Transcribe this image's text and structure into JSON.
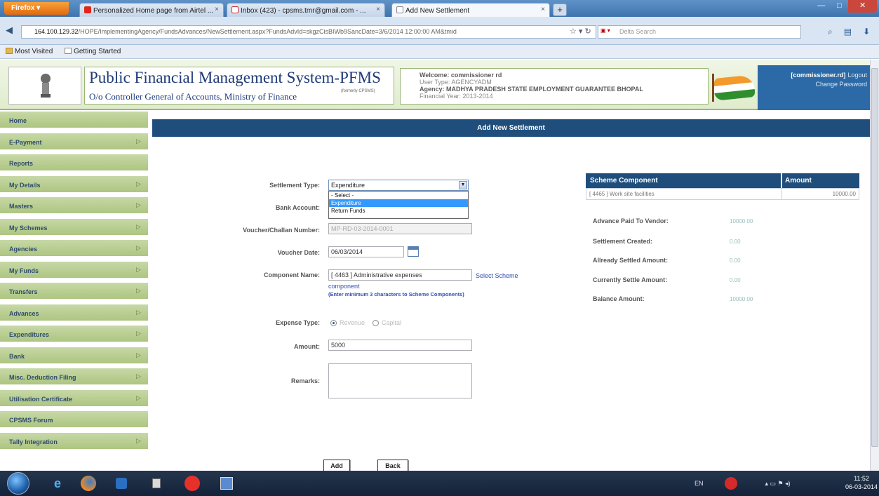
{
  "browser": {
    "menu_label": "Firefox",
    "tabs": [
      {
        "title": "Personalized Home page from Airtel ...",
        "icon": "airtel-icon"
      },
      {
        "title": "Inbox (423) - cpsms.tmr@gmail.com - ...",
        "icon": "gmail-icon"
      },
      {
        "title": "Add New Settlement",
        "icon": "page-icon"
      }
    ],
    "new_tab": "+",
    "url_host": "164.100.129.32",
    "url_path": "/HOPE/ImplementingAgency/FundsAdvances/NewSettlement.aspx?FundsAdvId=skgzCisBIWb9SancDate=3/6/2014 12:00:00 AM&tmid",
    "search_placeholder": "Delta Search",
    "bookmarks": [
      "Most Visited",
      "Getting Started"
    ]
  },
  "header": {
    "title": "Public Financial Management System-PFMS",
    "subtitle": "O/o Controller General of Accounts, Ministry of Finance",
    "powered": "(formerly CPSMS)",
    "welcome": "Welcome: commissioner rd",
    "user_type": "User Type: AGENCYADM",
    "agency": "Agency: MADHYA PRADESH STATE EMPLOYMENT GUARANTEE BHOPAL",
    "financial_year": "Financial Year: 2013-2014",
    "user_link": "[commissioner.rd]",
    "logout": "Logout",
    "change_password": "Change Password"
  },
  "sidebar": {
    "items": [
      {
        "label": "Home",
        "arrow": false
      },
      {
        "label": "E-Payment",
        "arrow": true
      },
      {
        "label": "Reports",
        "arrow": false
      },
      {
        "label": "My Details",
        "arrow": true
      },
      {
        "label": "Masters",
        "arrow": true
      },
      {
        "label": "My Schemes",
        "arrow": true
      },
      {
        "label": "Agencies",
        "arrow": true
      },
      {
        "label": "My Funds",
        "arrow": true
      },
      {
        "label": "Transfers",
        "arrow": true
      },
      {
        "label": "Advances",
        "arrow": true
      },
      {
        "label": "Expenditures",
        "arrow": true
      },
      {
        "label": "Bank",
        "arrow": true
      },
      {
        "label": "Misc. Deduction Filing",
        "arrow": true
      },
      {
        "label": "Utilisation Certificate",
        "arrow": true
      },
      {
        "label": "CPSMS Forum",
        "arrow": false
      },
      {
        "label": "Tally Integration",
        "arrow": true
      }
    ],
    "arrow_glyph": "▷"
  },
  "form": {
    "title": "Add New Settlement",
    "settlement_type_label": "Settlement Type:",
    "settlement_type_value": "Expenditure",
    "settlement_type_options": [
      "- Select -",
      "Expenditure",
      "Return Funds"
    ],
    "bank_account_label": "Bank Account:",
    "voucher_number_label": "Voucher/Challan Number:",
    "voucher_number_value": "MP-RD-03-2014-0001",
    "voucher_date_label": "Voucher Date:",
    "voucher_date_value": "06/03/2014",
    "component_name_label": "Component Name:",
    "component_name_value": "[ 4463 ] Administrative expenses",
    "select_scheme_link": "Select Scheme",
    "component_link": "component",
    "component_hint": "(Enter minimum 3 characters to Scheme Components)",
    "expense_type_label": "Expense Type:",
    "expense_type_options": [
      "Revenue",
      "Capital"
    ],
    "expense_type_selected": "Revenue",
    "amount_label": "Amount:",
    "amount_value": "5000",
    "remarks_label": "Remarks:",
    "add_button": "Add",
    "back_button": "Back"
  },
  "scheme_panel": {
    "col_component": "Scheme Component",
    "col_amount": "Amount",
    "row_component": "[ 4465 ] Work site facilities",
    "row_amount": "10000.00",
    "summary": [
      {
        "label": "Advance Paid To Vendor:",
        "value": "10000.00"
      },
      {
        "label": "Settlement Created:",
        "value": "0.00"
      },
      {
        "label": "Allready Settled Amount:",
        "value": "0.00"
      },
      {
        "label": "Currently Settle Amount:",
        "value": "0.00"
      },
      {
        "label": "Balance Amount:",
        "value": "10000.00"
      }
    ]
  },
  "taskbar": {
    "lang": "EN",
    "time": "11:52",
    "date": "06-03-2014"
  },
  "colors": {
    "header_bar": "#1f4e7c",
    "sidebar": "#b7cd8e",
    "selection": "#3399ff",
    "link": "#3150b0"
  }
}
